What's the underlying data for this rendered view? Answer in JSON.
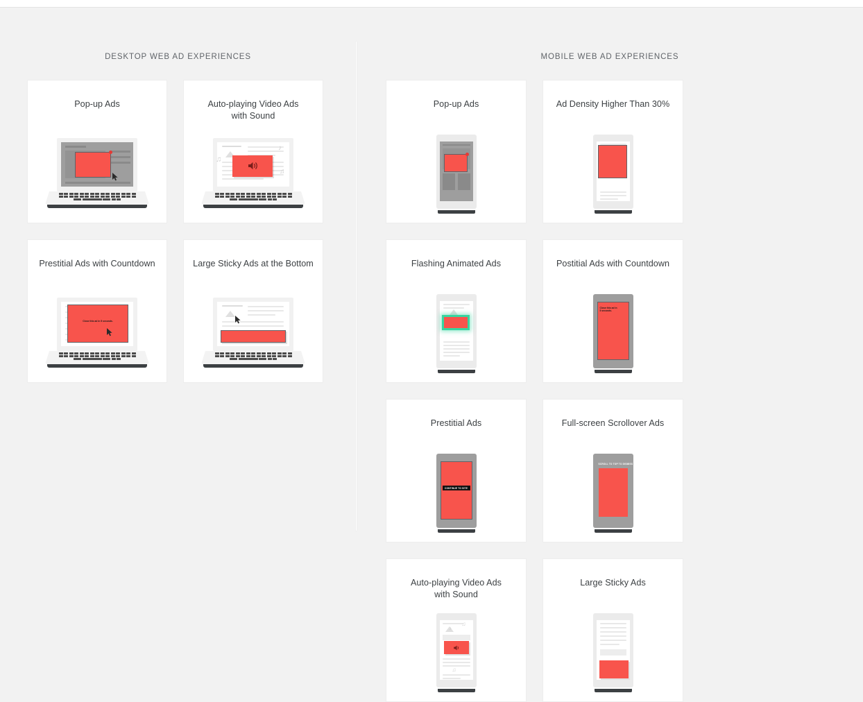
{
  "sections": [
    {
      "id": "desktop",
      "heading": "DESKTOP WEB AD EXPERIENCES",
      "cards": [
        {
          "title": "Pop-up Ads",
          "device": "laptop",
          "variant": "popup"
        },
        {
          "title": "Auto-playing Video Ads\nwith Sound",
          "device": "laptop",
          "variant": "video"
        },
        {
          "title": "Prestitial Ads with Countdown",
          "device": "laptop",
          "variant": "prestitial-countdown",
          "ad_text": "Close this ad in 5 seconds."
        },
        {
          "title": "Large Sticky Ads at the Bottom",
          "device": "laptop",
          "variant": "sticky-bottom"
        }
      ]
    },
    {
      "id": "mobile",
      "heading": "MOBILE WEB AD EXPERIENCES",
      "cards": [
        {
          "title": "Pop-up Ads",
          "device": "phone",
          "variant": "popup"
        },
        {
          "title": "Ad Density Higher Than 30%",
          "device": "phone",
          "variant": "density"
        },
        {
          "title": "Flashing Animated Ads",
          "device": "phone",
          "variant": "flashing"
        },
        {
          "title": "Postitial Ads with Countdown",
          "device": "phone",
          "variant": "postitial-countdown",
          "ad_text": "Close this ad in\n5 seconds."
        },
        {
          "title": "Prestitial Ads",
          "device": "phone",
          "variant": "prestitial",
          "ad_text": "CONTINUE TO SITE"
        },
        {
          "title": "Full-screen Scrollover Ads",
          "device": "phone",
          "variant": "scrollover",
          "ad_text": "SCROLL TO TOP TO DISMISS"
        },
        {
          "title": "Auto-playing Video Ads\nwith Sound",
          "device": "phone",
          "variant": "video"
        },
        {
          "title": "Large Sticky Ads",
          "device": "phone",
          "variant": "sticky"
        }
      ]
    }
  ],
  "colors": {
    "page_background": "#f2f2f2",
    "card_background": "#ffffff",
    "ad_red": "#f8544c",
    "flash_accent": "#37d6a0",
    "text": "#3c4043",
    "heading_text": "#5f6368",
    "device_dark": "#3c4043"
  }
}
